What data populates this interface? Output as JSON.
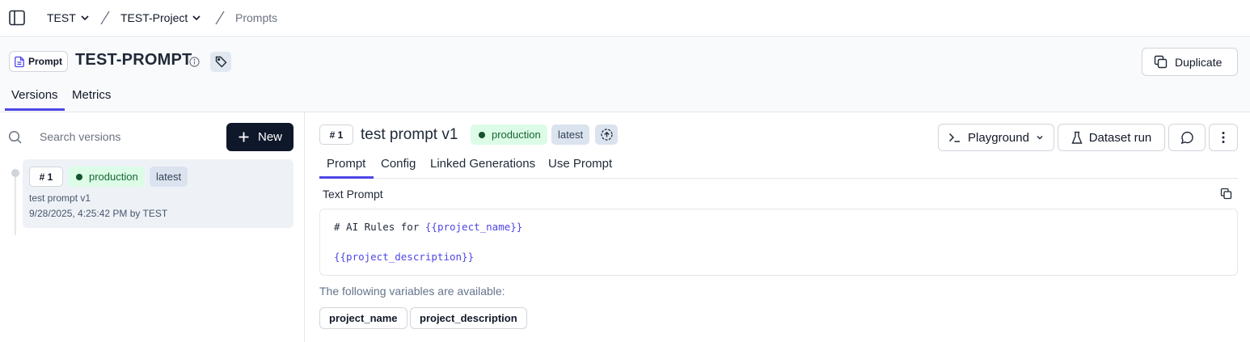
{
  "breadcrumb": {
    "org": "TEST",
    "project": "TEST-Project",
    "page": "Prompts"
  },
  "header": {
    "type_badge": "Prompt",
    "title": "TEST-PROMPT",
    "duplicate_label": "Duplicate",
    "tabs": [
      {
        "label": "Versions",
        "active": true
      },
      {
        "label": "Metrics",
        "active": false
      }
    ]
  },
  "versions_panel": {
    "search_placeholder": "Search versions",
    "new_label": "New",
    "items": [
      {
        "number": "# 1",
        "labels": [
          "production",
          "latest"
        ],
        "name": "test prompt v1",
        "meta": "9/28/2025, 4:25:42 PM by TEST"
      }
    ]
  },
  "detail": {
    "number": "# 1",
    "title": "test prompt v1",
    "labels": [
      "production",
      "latest"
    ],
    "toolbar": {
      "playground_label": "Playground",
      "dataset_run_label": "Dataset run"
    },
    "tabs": [
      {
        "label": "Prompt",
        "active": true
      },
      {
        "label": "Config",
        "active": false
      },
      {
        "label": "Linked Generations",
        "active": false
      },
      {
        "label": "Use Prompt",
        "active": false
      }
    ],
    "section_label": "Text Prompt",
    "code_line_1_prefix": "# AI Rules for ",
    "code_line_1_var": "{{project_name}}",
    "code_line_2_var": "{{project_description}}",
    "variables_note": "The following variables are available:",
    "variables": [
      "project_name",
      "project_description"
    ]
  },
  "colors": {
    "accent": "#4f46e5",
    "production_bg": "#dcfce7",
    "latest_bg": "#dbe3ef",
    "primary_button": "#0f172a"
  }
}
